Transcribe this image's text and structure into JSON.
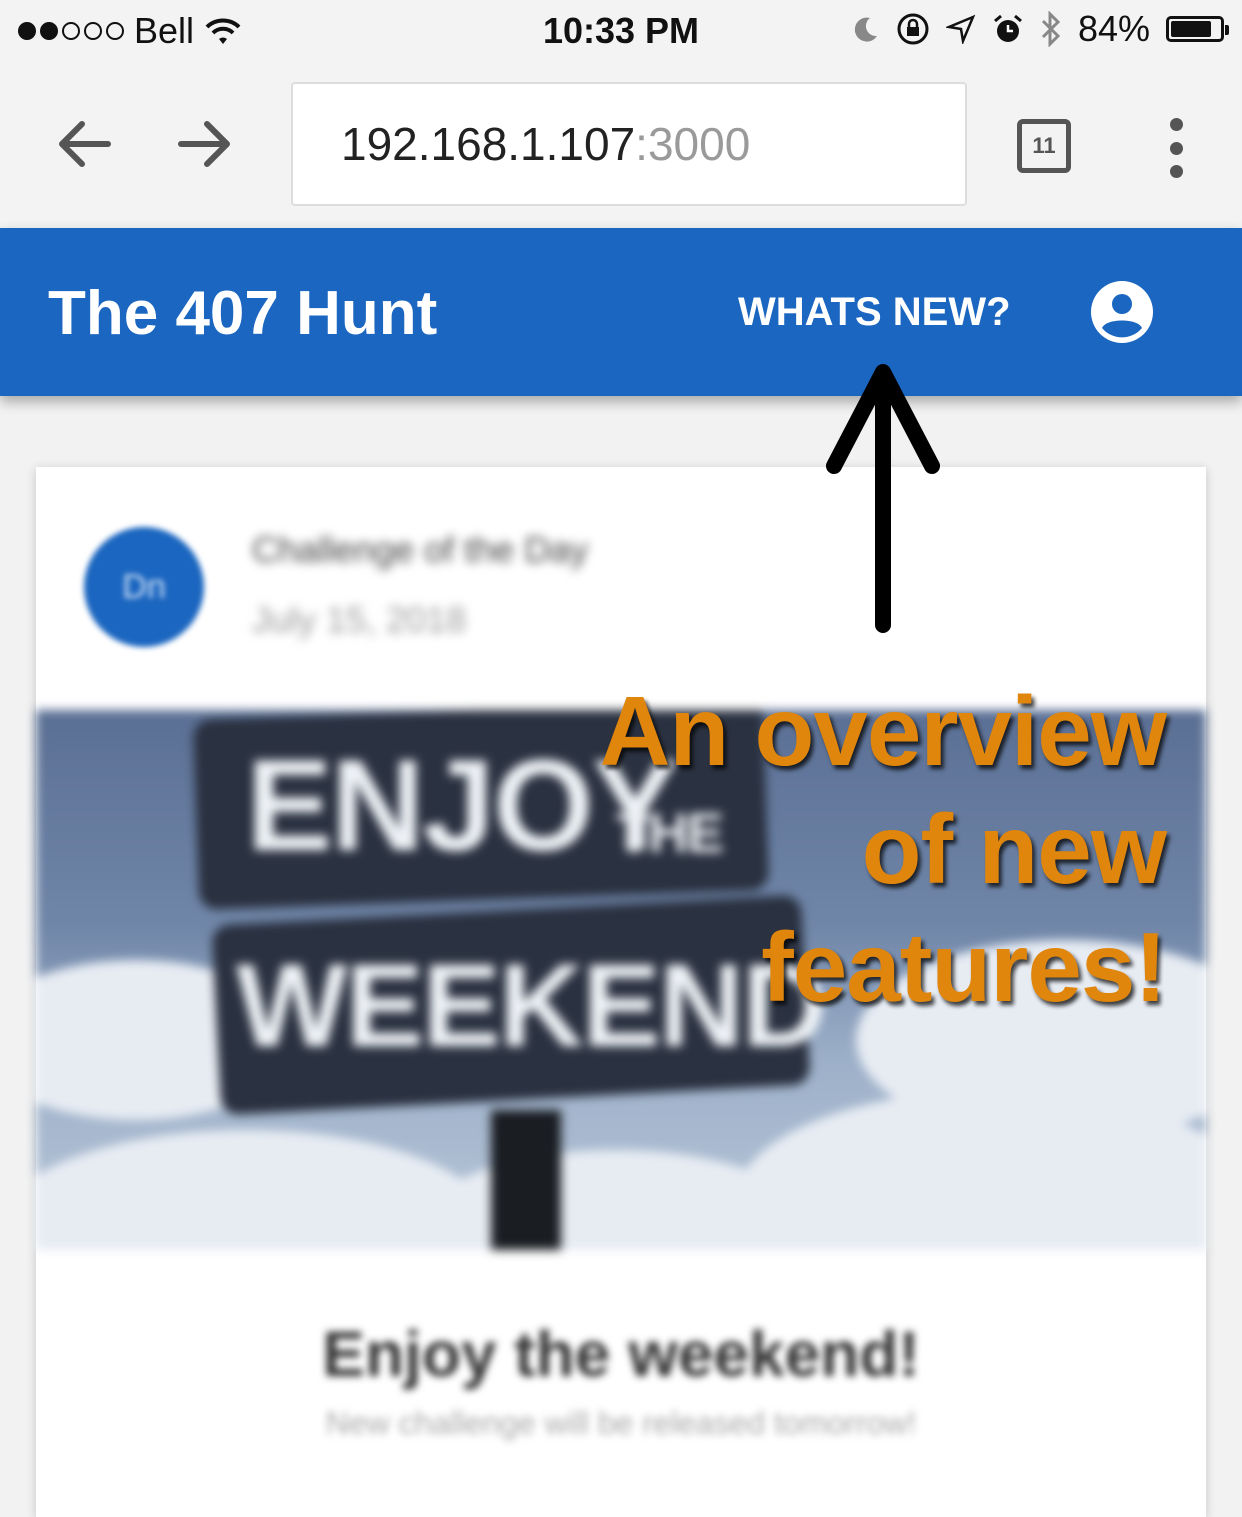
{
  "status_bar": {
    "carrier": "Bell",
    "time": "10:33 PM",
    "battery": "84%",
    "battery_level": 0.84,
    "signal_bars_filled": 2,
    "signal_bars_total": 5
  },
  "browser": {
    "url_host": "192.168.1.107",
    "url_port": ":3000",
    "tab_count": "11"
  },
  "app_bar": {
    "title": "The 407 Hunt",
    "whats_new": "WHATS NEW?",
    "color": "#1b66c0"
  },
  "card": {
    "avatar_text": "Dn",
    "title": "Challenge of the Day",
    "date": "July 15, 2018",
    "image_sign_line1": "ENJOY",
    "image_sign_line1_small": "THE",
    "image_sign_line2": "WEEKEND",
    "headline": "Enjoy the weekend!",
    "subtext": "New challenge will be released tomorrow!"
  },
  "annotation": {
    "lines": [
      "An overview",
      "of new",
      "features!"
    ],
    "color": "#e0860d"
  }
}
